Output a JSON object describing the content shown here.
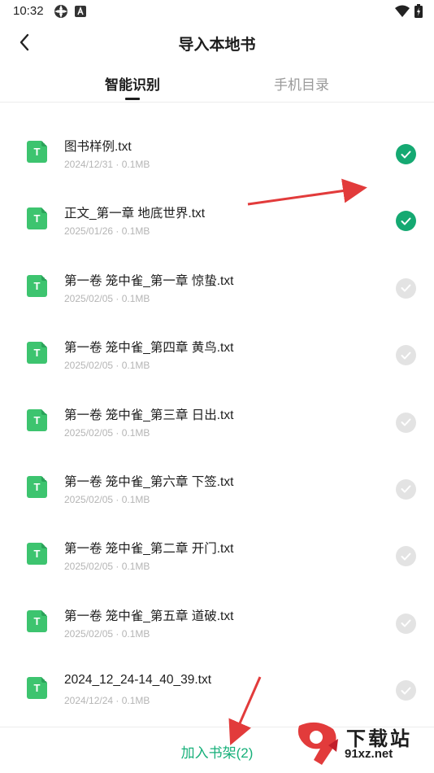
{
  "status_bar": {
    "time": "10:32"
  },
  "header": {
    "title": "导入本地书"
  },
  "tabs": [
    {
      "label": "智能识别",
      "active": true
    },
    {
      "label": "手机目录",
      "active": false
    }
  ],
  "files": [
    {
      "icon_letter": "T",
      "name": "图书样例.txt",
      "meta": "2024/12/31 · 0.1MB",
      "checked": true
    },
    {
      "icon_letter": "T",
      "name": "正文_第一章 地底世界.txt",
      "meta": "2025/01/26 · 0.1MB",
      "checked": true
    },
    {
      "icon_letter": "T",
      "name": "第一卷 笼中雀_第一章 惊蛰.txt",
      "meta": "2025/02/05 · 0.1MB",
      "checked": false
    },
    {
      "icon_letter": "T",
      "name": "第一卷 笼中雀_第四章 黄鸟.txt",
      "meta": "2025/02/05 · 0.1MB",
      "checked": false
    },
    {
      "icon_letter": "T",
      "name": "第一卷 笼中雀_第三章 日出.txt",
      "meta": "2025/02/05 · 0.1MB",
      "checked": false
    },
    {
      "icon_letter": "T",
      "name": "第一卷 笼中雀_第六章 下签.txt",
      "meta": "2025/02/05 · 0.1MB",
      "checked": false
    },
    {
      "icon_letter": "T",
      "name": "第一卷 笼中雀_第二章 开门.txt",
      "meta": "2025/02/05 · 0.1MB",
      "checked": false
    },
    {
      "icon_letter": "T",
      "name": "第一卷 笼中雀_第五章 道破.txt",
      "meta": "2025/02/05 · 0.1MB",
      "checked": false
    },
    {
      "icon_letter": "T",
      "name": "2024_12_24-14_40_39.txt",
      "meta": "2024/12/24 · 0.1MB",
      "checked": false
    }
  ],
  "bottom": {
    "add_label": "加入书架(2)"
  },
  "watermark": {
    "text": "下载站",
    "url": "91xz.net"
  },
  "colors": {
    "accent": "#15a972",
    "file_icon": "#3dc46f",
    "annotation": "#e23b3b"
  }
}
